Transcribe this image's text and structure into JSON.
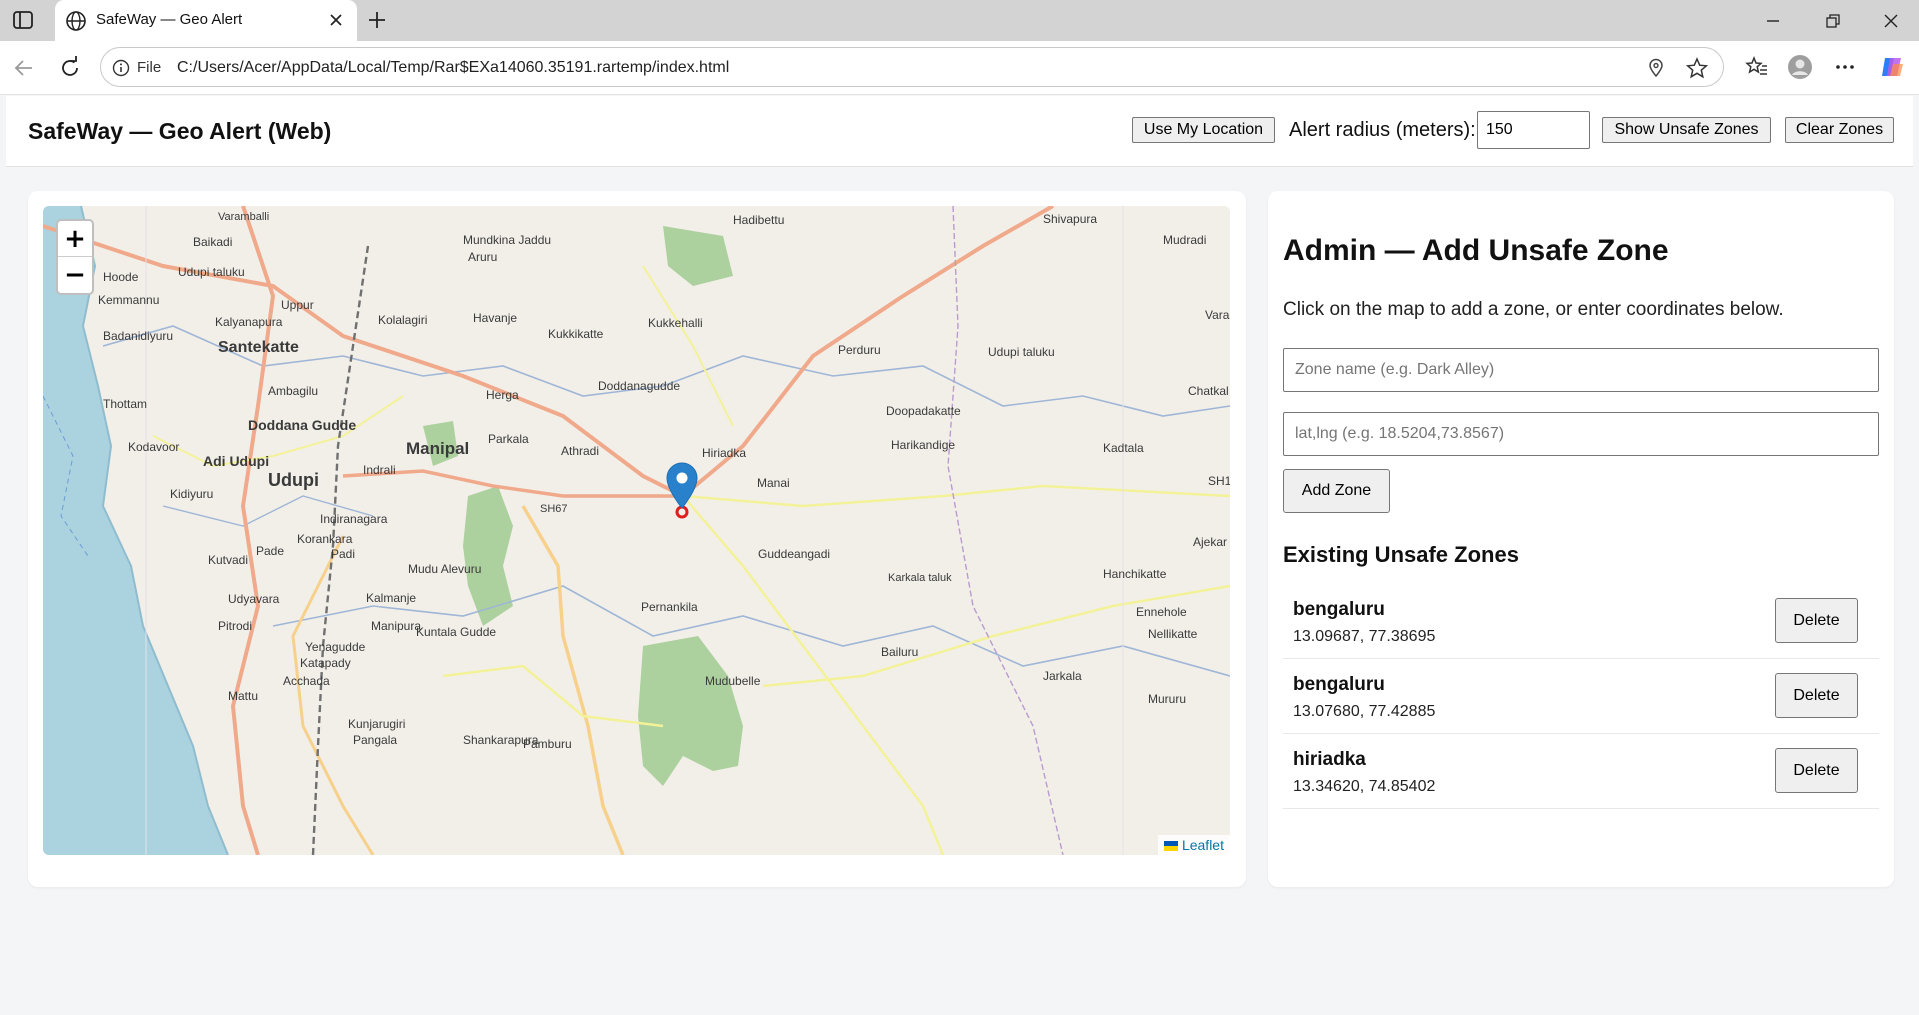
{
  "browser": {
    "tab_title": "SafeWay — Geo Alert",
    "address_scheme": "File",
    "address_url": "C:/Users/Acer/AppData/Local/Temp/Rar$EXa14060.35191.rartemp/index.html"
  },
  "header": {
    "title": "SafeWay — Geo Alert (Web)",
    "use_location_label": "Use My Location",
    "radius_label": "Alert radius (meters):",
    "radius_value": "150",
    "show_zones_label": "Show Unsafe Zones",
    "clear_zones_label": "Clear Zones"
  },
  "map": {
    "zoom_in": "+",
    "zoom_out": "−",
    "attribution": "Leaflet",
    "places": [
      "Varamballi",
      "Baikadi",
      "Mundkina Jaddu",
      "Aruru",
      "Hadibettu",
      "Shivapura",
      "Mudradi",
      "Hoode",
      "Udupi taluku",
      "Kemmannu",
      "Uppur",
      "Kalyanapura",
      "Kolalagiri",
      "Havanje",
      "Kukkehalli",
      "Badanidiyuru",
      "Santekatte",
      "Kukkikatte",
      "Perduru",
      "Udupi taluku",
      "Varar",
      "Ambagilu",
      "Herga",
      "Doddanagudde",
      "Chatkal",
      "Thottam",
      "Doopadakatte",
      "Doddana Gudde",
      "Manipal",
      "Parkala",
      "Kodavoor",
      "Adi Udupi",
      "Indrali",
      "Athradi",
      "Hiriadka",
      "Harikandige",
      "Kadtala",
      "Udupi",
      "Manai",
      "SH1",
      "Kidiyuru",
      "SH67",
      "Indiranagara",
      "Korankara",
      "Pade",
      "Padi",
      "Ajekar",
      "Kutvadi",
      "Mudu Alevuru",
      "Guddeangadi",
      "Karkala taluk",
      "Hanchikatte",
      "Udyavara",
      "Kalmanje",
      "Pernankila",
      "Ennehole",
      "Pitrodi",
      "Manipura",
      "Kuntala Gudde",
      "Nellikatte",
      "Yenagudde",
      "Katapady",
      "Bailuru",
      "Acchada",
      "Mudubelle",
      "Jarkala",
      "Mattu",
      "Kunjarugiri",
      "Mururu",
      "Pangala",
      "Shankarapura",
      "Pamburu"
    ]
  },
  "admin": {
    "title": "Admin — Add Unsafe Zone",
    "hint": "Click on the map to add a zone, or enter coordinates below.",
    "name_placeholder": "Zone name (e.g. Dark Alley)",
    "coords_placeholder": "lat,lng (e.g. 18.5204,73.8567)",
    "add_label": "Add Zone",
    "existing_title": "Existing Unsafe Zones",
    "zones": [
      {
        "name": "bengaluru",
        "coords": "13.09687, 77.38695",
        "delete": "Delete"
      },
      {
        "name": "bengaluru",
        "coords": "13.07680, 77.42885",
        "delete": "Delete"
      },
      {
        "name": "hiriadka",
        "coords": "13.34620, 74.85402",
        "delete": "Delete"
      }
    ]
  },
  "colors": {
    "accent_marker": "#2a81cb",
    "radius_ring": "#e21b1b",
    "link": "#0078a8"
  }
}
